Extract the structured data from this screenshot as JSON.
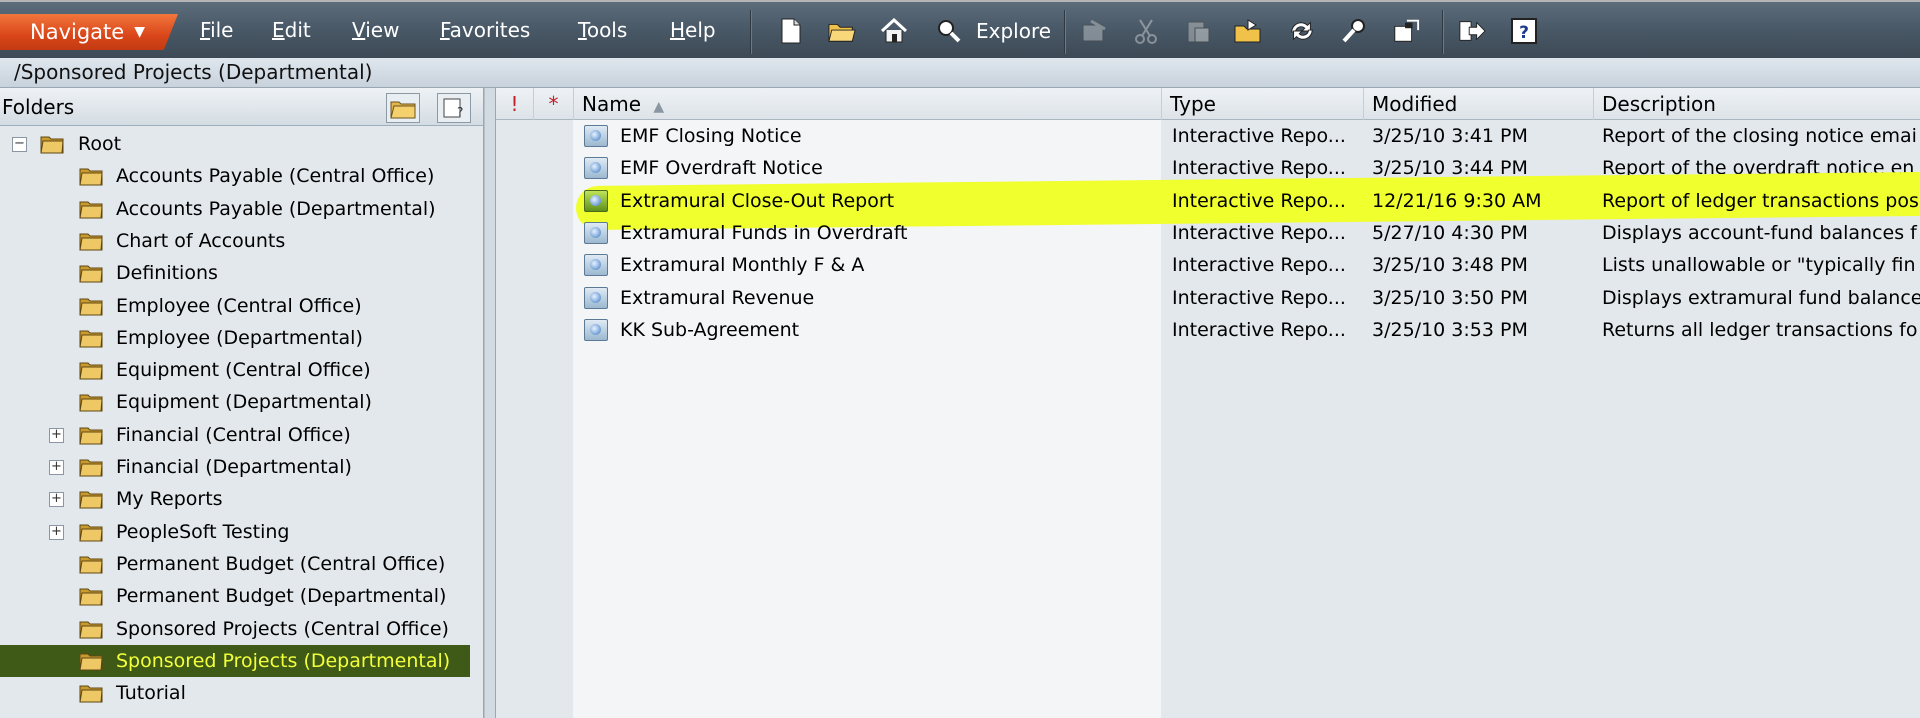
{
  "toolbar": {
    "navigate_label": "Navigate",
    "menus": [
      "File",
      "Edit",
      "View",
      "Favorites",
      "Tools",
      "Help"
    ],
    "explore_label": "Explore",
    "brand_color": "#d9461a"
  },
  "path": "/Sponsored Projects (Departmental)",
  "folders": {
    "title": "Folders",
    "root_label": "Root",
    "items": [
      {
        "label": "Accounts Payable (Central Office)",
        "expandable": false
      },
      {
        "label": "Accounts Payable (Departmental)",
        "expandable": false
      },
      {
        "label": "Chart of Accounts",
        "expandable": false
      },
      {
        "label": "Definitions",
        "expandable": false
      },
      {
        "label": "Employee (Central Office)",
        "expandable": false
      },
      {
        "label": "Employee (Departmental)",
        "expandable": false
      },
      {
        "label": "Equipment (Central Office)",
        "expandable": false
      },
      {
        "label": "Equipment (Departmental)",
        "expandable": false
      },
      {
        "label": "Financial (Central Office)",
        "expandable": true
      },
      {
        "label": "Financial (Departmental)",
        "expandable": true
      },
      {
        "label": "My Reports",
        "expandable": true
      },
      {
        "label": "PeopleSoft Testing",
        "expandable": true
      },
      {
        "label": "Permanent Budget (Central Office)",
        "expandable": false
      },
      {
        "label": "Permanent Budget (Departmental)",
        "expandable": false
      },
      {
        "label": "Sponsored Projects (Central Office)",
        "expandable": false
      },
      {
        "label": "Sponsored Projects (Departmental)",
        "expandable": false,
        "selected": true
      },
      {
        "label": "Tutorial",
        "expandable": false
      }
    ]
  },
  "list": {
    "headers": {
      "flag": "!",
      "star": "*",
      "name": "Name",
      "type": "Type",
      "modified": "Modified",
      "description": "Description"
    },
    "rows": [
      {
        "name": "EMF Closing Notice",
        "type": "Interactive Repo...",
        "modified": "3/25/10 3:41 PM",
        "description": "Report of the closing notice emai"
      },
      {
        "name": "EMF Overdraft Notice",
        "type": "Interactive Repo...",
        "modified": "3/25/10 3:44 PM",
        "description": "Report of the overdraft notice en"
      },
      {
        "name": "Extramural Close-Out Report",
        "type": "Interactive Repo...",
        "modified": "12/21/16 9:30 AM",
        "description": "Report of ledger transactions pos",
        "highlighted": true
      },
      {
        "name": "Extramural Funds in Overdraft",
        "type": "Interactive Repo...",
        "modified": "5/27/10 4:30 PM",
        "description": "Displays account-fund balances f"
      },
      {
        "name": "Extramural Monthly F & A",
        "type": "Interactive Repo...",
        "modified": "3/25/10 3:48 PM",
        "description": "Lists unallowable or \"typically fin"
      },
      {
        "name": "Extramural Revenue",
        "type": "Interactive Repo...",
        "modified": "3/25/10 3:50 PM",
        "description": "Displays extramural fund balance"
      },
      {
        "name": "KK Sub-Agreement",
        "type": "Interactive Repo...",
        "modified": "3/25/10 3:53 PM",
        "description": "Returns all ledger transactions fo"
      }
    ]
  }
}
